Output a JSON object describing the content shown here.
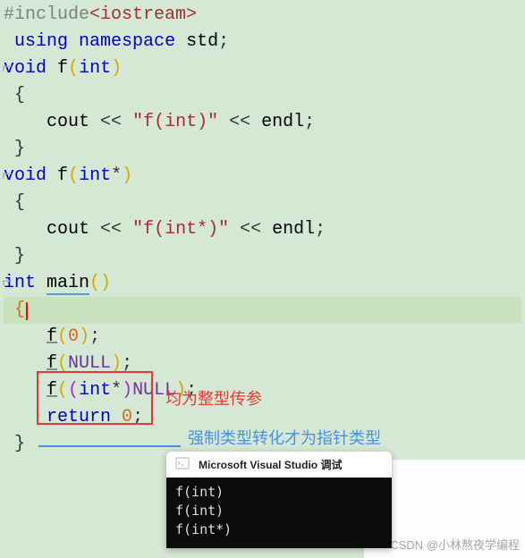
{
  "code": {
    "l1_pre": "#include",
    "l1_inc": "<iostream>",
    "l2_kw1": "using",
    "l2_kw2": "namespace",
    "l2_ns": "std",
    "l3_kw": "void",
    "l3_fn": "f",
    "l3_ty": "int",
    "l6_cout": "cout",
    "l6_op": "<<",
    "l6_str": "\"f(int)\"",
    "l6_endl": "endl",
    "l8_kw": "void",
    "l8_fn": "f",
    "l8_ty": "int",
    "l8_star": "*",
    "l11_cout": "cout",
    "l11_op": "<<",
    "l11_str": "\"f(int*)\"",
    "l11_endl": "endl",
    "l13_kw": "int",
    "l13_fn": "main",
    "l15_fn": "f",
    "l15_arg": "0",
    "l16_fn": "f",
    "l16_arg": "NULL",
    "l17_fn": "f",
    "l17_cast_ty": "int",
    "l17_star": "*",
    "l17_arg": "NULL",
    "l18_kw": "return",
    "l18_val": "0"
  },
  "annotations": {
    "red": "均为整型传参",
    "blue": "强制类型转化才为指针类型"
  },
  "debug": {
    "title": "Microsoft Visual Studio 调试",
    "out1": "f(int)",
    "out2": "f(int)",
    "out3": "f(int*)"
  },
  "watermark": "CSDN @小林熬夜学编程"
}
